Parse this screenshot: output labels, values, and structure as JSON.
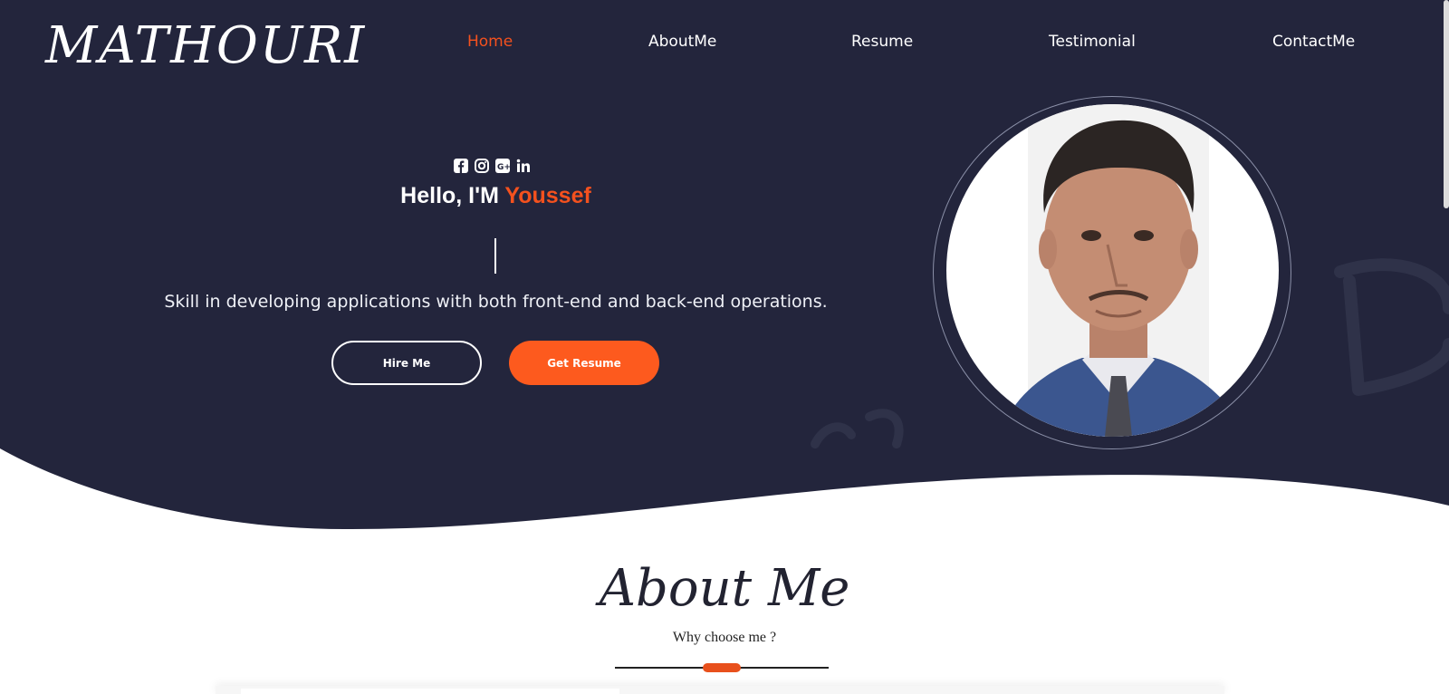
{
  "brand": {
    "logo_text": "MATHOURI"
  },
  "nav": {
    "home": "Home",
    "about": "AboutMe",
    "resume": "Resume",
    "testimonial": "Testimonial",
    "contact": "ContactMe",
    "active": "Home"
  },
  "hero": {
    "socials": [
      "facebook-icon",
      "instagram-icon",
      "google-plus-icon",
      "linkedin-icon"
    ],
    "greeting_prefix": "Hello, I'M ",
    "greeting_name": "Youssef",
    "tagline": "Skill in developing applications with both front-end and back-end operations.",
    "hire_button": "Hire Me",
    "resume_button": "Get Resume"
  },
  "about": {
    "title": "About Me",
    "subtitle": "Why choose me ?"
  },
  "colors": {
    "navy": "#23253c",
    "accent": "#f4511e",
    "white": "#ffffff"
  }
}
